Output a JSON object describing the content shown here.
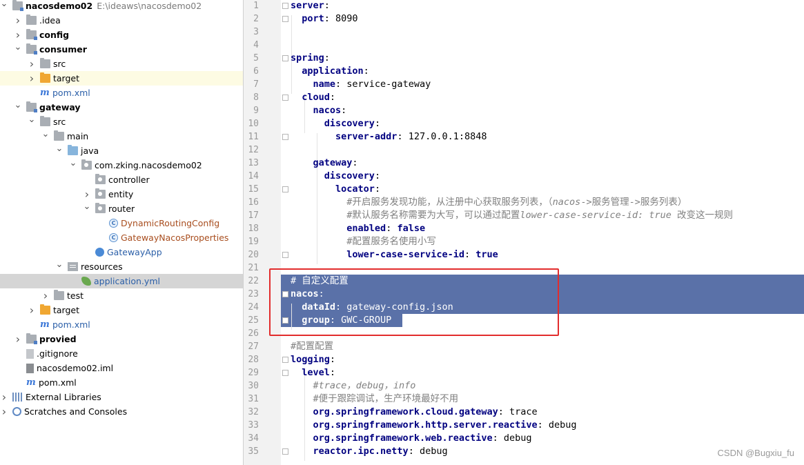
{
  "project_tree": [
    {
      "label": "nacosdemo02",
      "path": "E:\\ideaws\\nacosdemo02",
      "bold": true,
      "arrow": "down",
      "icon": "module-folder",
      "depth": 0
    },
    {
      "label": ".idea",
      "arrow": "right",
      "icon": "folder",
      "depth": 1
    },
    {
      "label": "config",
      "bold": true,
      "arrow": "right",
      "icon": "module-folder",
      "depth": 1
    },
    {
      "label": "consumer",
      "bold": true,
      "arrow": "down",
      "icon": "module-folder",
      "depth": 1
    },
    {
      "label": "src",
      "arrow": "right",
      "icon": "folder",
      "depth": 2
    },
    {
      "label": "target",
      "arrow": "right",
      "icon": "excluded-folder",
      "depth": 2,
      "highlight": "target"
    },
    {
      "label": "pom.xml",
      "icon": "maven-icon",
      "depth": 2,
      "color": "blue"
    },
    {
      "label": "gateway",
      "bold": true,
      "arrow": "down",
      "icon": "module-folder",
      "depth": 1
    },
    {
      "label": "src",
      "arrow": "down",
      "icon": "folder",
      "depth": 2
    },
    {
      "label": "main",
      "arrow": "down",
      "icon": "folder",
      "depth": 3
    },
    {
      "label": "java",
      "arrow": "down",
      "icon": "source-folder",
      "depth": 4
    },
    {
      "label": "com.zking.nacosdemo02",
      "arrow": "down",
      "icon": "package",
      "depth": 5
    },
    {
      "label": "controller",
      "icon": "package",
      "depth": 6
    },
    {
      "label": "entity",
      "arrow": "right",
      "icon": "package",
      "depth": 6
    },
    {
      "label": "router",
      "arrow": "down",
      "icon": "package",
      "depth": 6
    },
    {
      "label": "DynamicRoutingConfig",
      "icon": "class-icon",
      "depth": 7,
      "color": "orange"
    },
    {
      "label": "GatewayNacosProperties",
      "icon": "class-icon",
      "depth": 7,
      "color": "orange"
    },
    {
      "label": "GatewayApp",
      "icon": "spring-app-icon",
      "depth": 6,
      "color": "blue"
    },
    {
      "label": "resources",
      "arrow": "down",
      "icon": "resources-folder",
      "depth": 4
    },
    {
      "label": "application.yml",
      "icon": "yaml-icon",
      "depth": 5,
      "color": "blue",
      "selected": true
    },
    {
      "label": "test",
      "arrow": "right",
      "icon": "folder",
      "depth": 3
    },
    {
      "label": "target",
      "arrow": "right",
      "icon": "excluded-folder",
      "depth": 2
    },
    {
      "label": "pom.xml",
      "icon": "maven-icon",
      "depth": 2,
      "color": "blue"
    },
    {
      "label": "provied",
      "bold": true,
      "arrow": "right",
      "icon": "module-folder",
      "depth": 1
    },
    {
      "label": ".gitignore",
      "icon": "file-icon",
      "depth": 1
    },
    {
      "label": "nacosdemo02.iml",
      "icon": "iml-file-icon",
      "depth": 1
    },
    {
      "label": "pom.xml",
      "icon": "maven-icon",
      "depth": 1
    },
    {
      "label": "External Libraries",
      "arrow": "right",
      "icon": "libraries-icon",
      "depth": 0
    },
    {
      "label": "Scratches and Consoles",
      "arrow": "right",
      "icon": "scratches-icon",
      "depth": 0
    }
  ],
  "editor": {
    "lines": [
      {
        "n": "1",
        "parts": [
          [
            "k",
            "server"
          ],
          [
            "v",
            ":"
          ]
        ]
      },
      {
        "n": "2",
        "parts": [
          [
            "v",
            "  "
          ],
          [
            "k",
            "port"
          ],
          [
            "v",
            ": 8090"
          ]
        ]
      },
      {
        "n": "3",
        "parts": []
      },
      {
        "n": "4",
        "parts": []
      },
      {
        "n": "5",
        "parts": [
          [
            "k",
            "spring"
          ],
          [
            "v",
            ":"
          ]
        ]
      },
      {
        "n": "6",
        "parts": [
          [
            "v",
            "  "
          ],
          [
            "k",
            "application"
          ],
          [
            "v",
            ":"
          ]
        ]
      },
      {
        "n": "7",
        "parts": [
          [
            "v",
            "    "
          ],
          [
            "k",
            "name"
          ],
          [
            "v",
            ": service-gateway"
          ]
        ]
      },
      {
        "n": "8",
        "parts": [
          [
            "v",
            "  "
          ],
          [
            "k",
            "cloud"
          ],
          [
            "v",
            ":"
          ]
        ]
      },
      {
        "n": "9",
        "parts": [
          [
            "v",
            "    "
          ],
          [
            "k",
            "nacos"
          ],
          [
            "v",
            ":"
          ]
        ]
      },
      {
        "n": "10",
        "parts": [
          [
            "v",
            "      "
          ],
          [
            "k",
            "discovery"
          ],
          [
            "v",
            ":"
          ]
        ]
      },
      {
        "n": "11",
        "parts": [
          [
            "v",
            "        "
          ],
          [
            "k",
            "server-addr"
          ],
          [
            "v",
            ": 127.0.0.1:8848"
          ]
        ]
      },
      {
        "n": "12",
        "parts": []
      },
      {
        "n": "13",
        "parts": [
          [
            "v",
            "    "
          ],
          [
            "k",
            "gateway"
          ],
          [
            "v",
            ":"
          ]
        ]
      },
      {
        "n": "14",
        "parts": [
          [
            "v",
            "      "
          ],
          [
            "k",
            "discovery"
          ],
          [
            "v",
            ":"
          ]
        ]
      },
      {
        "n": "15",
        "parts": [
          [
            "v",
            "        "
          ],
          [
            "k",
            "locator"
          ],
          [
            "v",
            ":"
          ]
        ]
      },
      {
        "n": "16",
        "parts": [
          [
            "v",
            "          "
          ],
          [
            "cm",
            "#开启服务发现功能，从注册中心获取服务列表，（"
          ],
          [
            "cmi",
            "nacos"
          ],
          [
            "cm",
            "->服务管理->服务列表）"
          ]
        ]
      },
      {
        "n": "17",
        "parts": [
          [
            "v",
            "          "
          ],
          [
            "cm",
            "#默认服务名称需要为大写，可以通过配置"
          ],
          [
            "cmi",
            "lower-case-service-id: true "
          ],
          [
            "cm",
            "改变这一规则"
          ]
        ]
      },
      {
        "n": "18",
        "parts": [
          [
            "v",
            "          "
          ],
          [
            "k",
            "enabled"
          ],
          [
            "v",
            ": "
          ],
          [
            "kwv",
            "false"
          ]
        ]
      },
      {
        "n": "19",
        "parts": [
          [
            "v",
            "          "
          ],
          [
            "cm",
            "#配置服务名使用小写"
          ]
        ]
      },
      {
        "n": "20",
        "parts": [
          [
            "v",
            "          "
          ],
          [
            "k",
            "lower-case-service-id"
          ],
          [
            "v",
            ": "
          ],
          [
            "kwv",
            "true"
          ]
        ]
      },
      {
        "n": "21",
        "parts": []
      },
      {
        "n": "22",
        "parts": [
          [
            "cm",
            "# 自定义配置"
          ]
        ],
        "selected": true
      },
      {
        "n": "23",
        "parts": [
          [
            "k",
            "nacos"
          ],
          [
            "v",
            ":"
          ]
        ],
        "selected": true
      },
      {
        "n": "24",
        "parts": [
          [
            "v",
            "  "
          ],
          [
            "k",
            "dataId"
          ],
          [
            "v",
            ": gateway-config.json"
          ]
        ],
        "selected": true
      },
      {
        "n": "25",
        "parts": [
          [
            "v",
            "  "
          ],
          [
            "k",
            "group"
          ],
          [
            "v",
            ": GWC-GROUP"
          ]
        ],
        "selected": true
      },
      {
        "n": "26",
        "parts": []
      },
      {
        "n": "27",
        "parts": [
          [
            "cm",
            "#配置配置"
          ]
        ]
      },
      {
        "n": "28",
        "parts": [
          [
            "k",
            "logging"
          ],
          [
            "v",
            ":"
          ]
        ]
      },
      {
        "n": "29",
        "parts": [
          [
            "v",
            "  "
          ],
          [
            "k",
            "level"
          ],
          [
            "v",
            ":"
          ]
        ]
      },
      {
        "n": "30",
        "parts": [
          [
            "v",
            "    "
          ],
          [
            "cmi",
            "#trace，debug，info"
          ]
        ]
      },
      {
        "n": "31",
        "parts": [
          [
            "v",
            "    "
          ],
          [
            "cm",
            "#便于跟踪调试，生产环境最好不用"
          ]
        ]
      },
      {
        "n": "32",
        "parts": [
          [
            "v",
            "    "
          ],
          [
            "k",
            "org.springframework.cloud.gateway"
          ],
          [
            "v",
            ": trace"
          ]
        ]
      },
      {
        "n": "33",
        "parts": [
          [
            "v",
            "    "
          ],
          [
            "k",
            "org.springframework.http.server.reactive"
          ],
          [
            "v",
            ": debug"
          ]
        ]
      },
      {
        "n": "34",
        "parts": [
          [
            "v",
            "    "
          ],
          [
            "k",
            "org.springframework.web.reactive"
          ],
          [
            "v",
            ": debug"
          ]
        ]
      },
      {
        "n": "35",
        "parts": [
          [
            "v",
            "    "
          ],
          [
            "k",
            "reactor.ipc.netty"
          ],
          [
            "v",
            ": debug"
          ]
        ]
      }
    ],
    "fold_lines": [
      "1",
      "2",
      "5",
      "8",
      "11",
      "15",
      "20",
      "23",
      "25",
      "28",
      "29",
      "35"
    ]
  },
  "colors": {
    "selection": "#5a71a8",
    "annotation_box": "#e22c2c",
    "yaml_key": "#000080",
    "comment": "#808080"
  },
  "watermark": "CSDN @Bugxiu_fu"
}
